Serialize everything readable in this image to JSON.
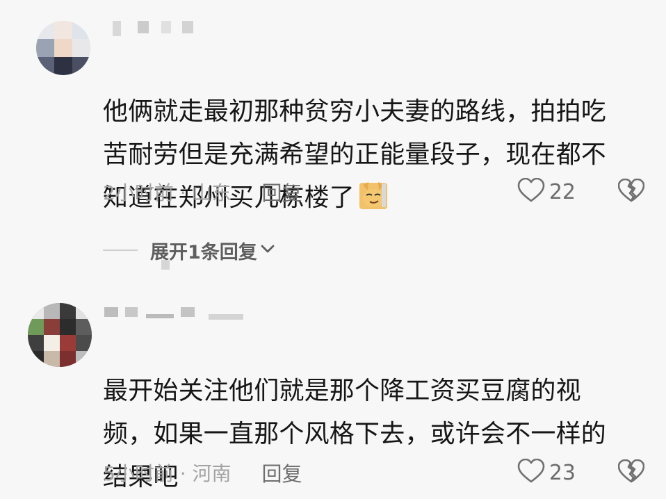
{
  "comments": [
    {
      "text": "他俩就走最初那种贫穷小夫妻的路线，拍拍吃\n苦耐劳但是充满希望的正能量段子，现在都不\n知道在郑州买几栋楼了",
      "emoji": "cat-smirk",
      "time_location": "2小时前 · 山东",
      "reply_label": "回复",
      "likes": "22"
    },
    {
      "text": "最开始关注他们就是那个降工资买豆腐的视\n频，如果一直那个风格下去，或许会不一样的\n结果吧",
      "time_location": "5小时前 · 河南",
      "reply_label": "回复",
      "likes": "23"
    }
  ],
  "expand_replies": {
    "label": "展开1条回复"
  },
  "icons": {
    "like": "heart-outline-icon",
    "dislike": "broken-heart-icon",
    "expand": "chevron-down-icon"
  },
  "colors": {
    "background": "#f7f7f7",
    "text": "#161616",
    "meta": "#a3a3a3"
  }
}
